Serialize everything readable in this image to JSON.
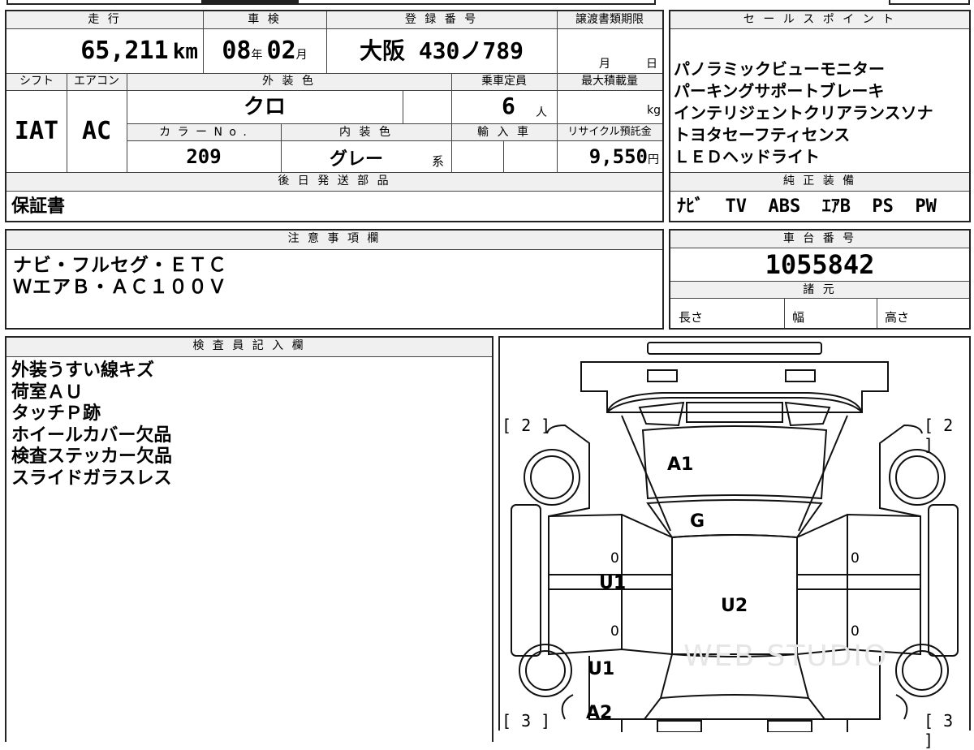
{
  "top_row": {
    "mileage_label": "走 行",
    "mileage_value": "65,211",
    "mileage_unit": "km",
    "shaken_label": "車 検",
    "shaken_year": "08",
    "shaken_year_unit": "年",
    "shaken_month": "02",
    "shaken_month_unit": "月",
    "reg_label": "登 録 番 号",
    "reg_value": "大阪 430ノ789",
    "transfer_label": "譲渡書類期限",
    "transfer_month_unit": "月",
    "transfer_day_unit": "日"
  },
  "second_row": {
    "shift_label": "シフト",
    "shift_value": "IAT",
    "ac_label": "エアコン",
    "ac_value": "AC",
    "exterior_label": "外 装 色",
    "exterior_value": "クロ",
    "capacity_label": "乗車定員",
    "capacity_value": "6",
    "capacity_unit": "人",
    "load_label": "最大積載量",
    "load_unit": "kg",
    "color_no_label": "カ ラ ー N o .",
    "color_no_value": "209",
    "interior_label": "内 装 色",
    "interior_value": "グレー",
    "interior_suffix": "系",
    "import_label": "輸 入 車",
    "recycle_label": "リサイクル預託金",
    "recycle_value": "9,550",
    "recycle_unit": "円"
  },
  "later_parts": {
    "label": "後 日 発 送 部 品",
    "value": "保証書"
  },
  "sales_points": {
    "label": "セ ー ル ス ポ イ ン ト",
    "items": [
      "パノラミックビューモニター",
      "パーキングサポートブレーキ",
      "インテリジェントクリアランスソナ",
      "トヨタセーフティセンス",
      "ＬＥＤヘッドライト"
    ]
  },
  "genuine_equipment": {
    "label": "純 正 装 備",
    "value": "ﾅﾋﾞ  TV  ABS  ｴｱB  PS  PW"
  },
  "notes": {
    "label": "注 意 事 項 欄",
    "lines": [
      "ナビ・フルセグ・ＥＴＣ",
      "ＷエアＢ・ＡＣ１００Ｖ"
    ]
  },
  "chassis": {
    "label": "車 台 番 号",
    "value": "1055842"
  },
  "specs": {
    "label": "諸 元",
    "length_label": "長さ",
    "width_label": "幅",
    "height_label": "高さ"
  },
  "inspector": {
    "label": "検 査 員 記 入 欄",
    "lines": [
      "外装うすい線キズ",
      "荷室ＡＵ",
      "タッチＰ跡",
      "ホイールカバー欠品",
      "検査ステッカー欠品",
      "スライドガラスレス"
    ]
  },
  "diagram": {
    "corner_tl": "[ 2 ]",
    "corner_tr": "[ 2 ]",
    "corner_bl": "[ 3 ]",
    "corner_br": "[ 3 ]",
    "mark_a1": "A1",
    "mark_g": "G",
    "mark_u1_side": "U1",
    "mark_u2": "U2",
    "mark_u1_rear": "U1",
    "mark_a2": "A2",
    "zero_left_upper": "0",
    "zero_left_lower": "0",
    "zero_right_upper": "0",
    "zero_right_lower": "0",
    "watermark": "WEB STUDIO"
  }
}
